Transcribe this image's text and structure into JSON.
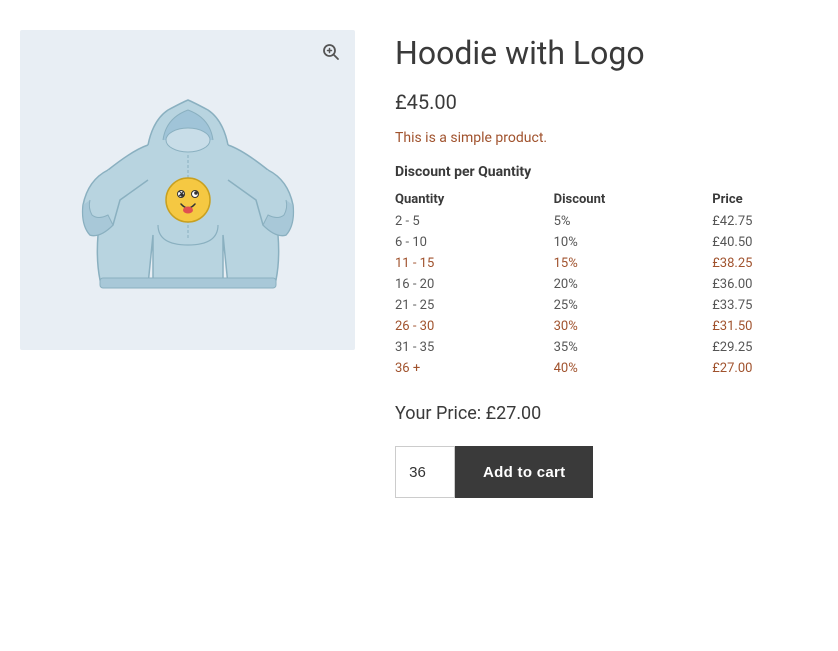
{
  "product": {
    "title": "Hoodie with Logo",
    "price": "£45.00",
    "description": "This is a simple product.",
    "discount_section_label": "Discount per Quantity",
    "your_price_label": "Your Price: £27.00",
    "table": {
      "headers": [
        "Quantity",
        "Discount",
        "Price"
      ],
      "rows": [
        {
          "quantity": "2 - 5",
          "discount": "5%",
          "price": "£42.75",
          "highlight": false
        },
        {
          "quantity": "6 - 10",
          "discount": "10%",
          "price": "£40.50",
          "highlight": false
        },
        {
          "quantity": "11 - 15",
          "discount": "15%",
          "price": "£38.25",
          "highlight": true
        },
        {
          "quantity": "16 - 20",
          "discount": "20%",
          "price": "£36.00",
          "highlight": false
        },
        {
          "quantity": "21 - 25",
          "discount": "25%",
          "price": "£33.75",
          "highlight": false
        },
        {
          "quantity": "26 - 30",
          "discount": "30%",
          "price": "£31.50",
          "highlight": true
        },
        {
          "quantity": "31 - 35",
          "discount": "35%",
          "price": "£29.25",
          "highlight": false
        },
        {
          "quantity": "36 +",
          "discount": "40%",
          "price": "£27.00",
          "highlight": true
        }
      ]
    },
    "quantity_value": "36",
    "add_to_cart_label": "Add to cart"
  }
}
